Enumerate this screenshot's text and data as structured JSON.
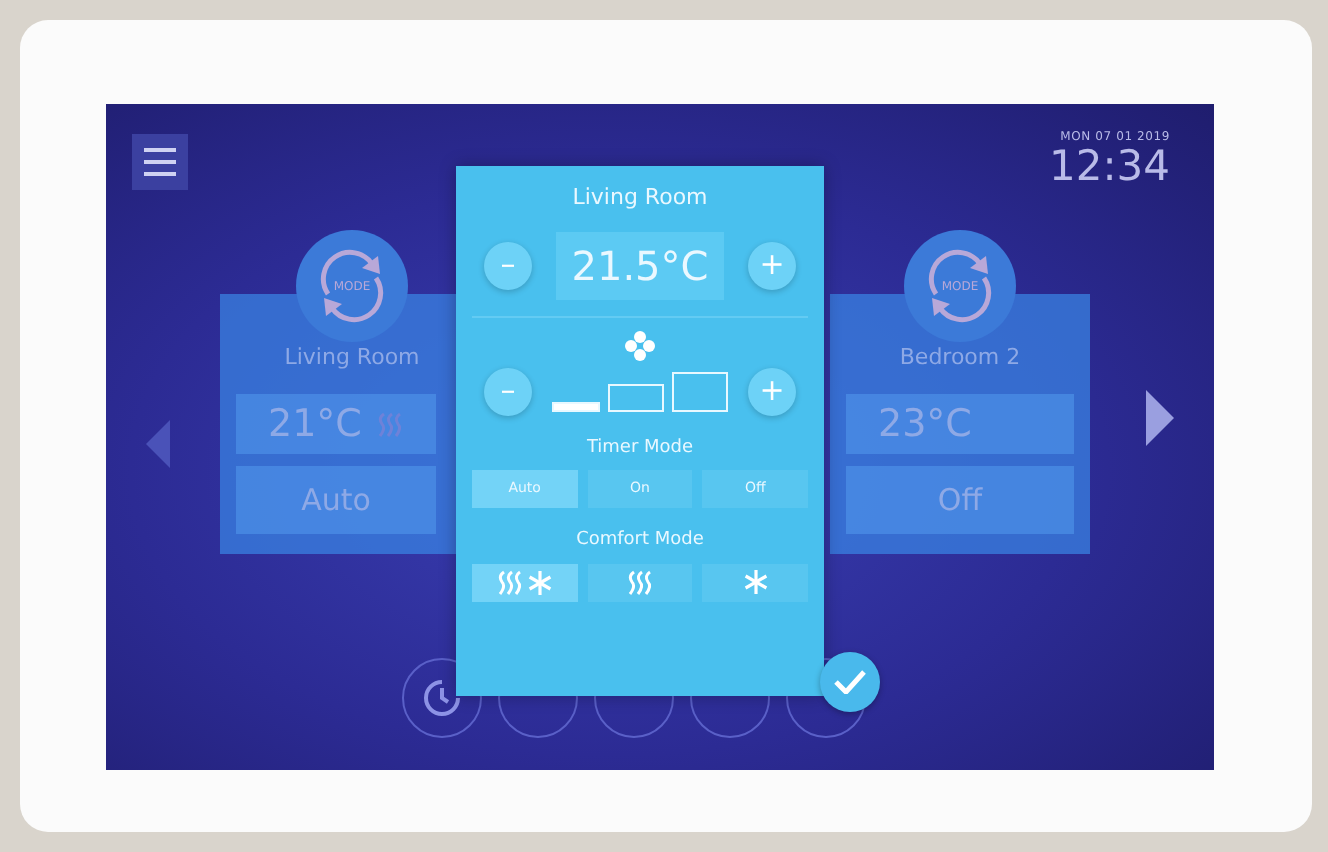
{
  "header": {
    "date": "MON 07 01 2019",
    "time": "12:34"
  },
  "zones": [
    {
      "mode_label": "MODE",
      "name": "Living Room",
      "temperature": "21°C",
      "heating": true,
      "mode": "Auto"
    },
    {
      "mode_label": "MODE",
      "name": "Bedroom 2",
      "temperature": "23°C",
      "heating": false,
      "mode": "Off"
    }
  ],
  "bottom_buttons": [
    {
      "kind": "clock"
    },
    {
      "kind": "plain"
    },
    {
      "kind": "plain"
    },
    {
      "kind": "plain"
    },
    {
      "kind": "plain"
    }
  ],
  "popup": {
    "title": "Living Room",
    "minus": "–",
    "plus": "+",
    "setpoint": "21.5°C",
    "fan_speeds": [
      {
        "on": true
      },
      {
        "on": false
      },
      {
        "on": false
      }
    ],
    "timer_title": "Timer Mode",
    "timer_options": [
      {
        "label": "Auto",
        "selected": true
      },
      {
        "label": "On",
        "selected": false
      },
      {
        "label": "Off",
        "selected": false
      }
    ],
    "comfort_title": "Comfort Mode",
    "comfort_options": [
      {
        "kind": "heat-cool",
        "selected": true
      },
      {
        "kind": "heat",
        "selected": false
      },
      {
        "kind": "cool",
        "selected": false
      }
    ]
  }
}
